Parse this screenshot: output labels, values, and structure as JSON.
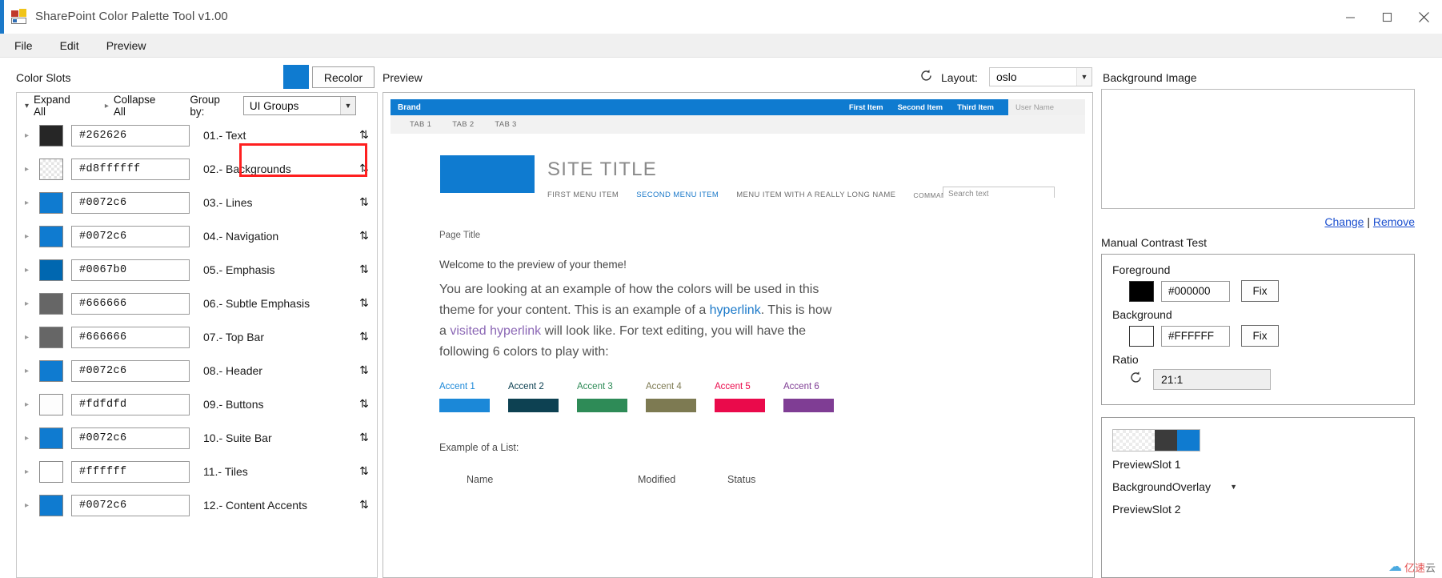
{
  "window": {
    "title": "SharePoint Color Palette Tool v1.00",
    "icon": "app-palette-icon",
    "minimize": "minimize-icon",
    "maximize": "maximize-icon",
    "close": "close-icon"
  },
  "menubar": {
    "items": [
      {
        "label": "File"
      },
      {
        "label": "Edit"
      },
      {
        "label": "Preview"
      }
    ]
  },
  "left_panel": {
    "heading": "Color Slots",
    "recolor_label": "Recolor",
    "recolor_swatch_color": "#0f7bd0",
    "toolbar": {
      "expand_all": "Expand All",
      "collapse_all": "Collapse All",
      "group_by_label": "Group by:",
      "group_by_value": "UI Groups",
      "highlight_color": "#ff1f1f"
    },
    "sort_glyph": "⇅",
    "slots": [
      {
        "hex": "#262626",
        "name": "01.- Text",
        "color": "#262626",
        "checker": false
      },
      {
        "hex": "#d8ffffff",
        "name": "02.- Backgrounds",
        "color": "",
        "checker": true
      },
      {
        "hex": "#0072c6",
        "name": "03.- Lines",
        "color": "#0f7bd0",
        "checker": false
      },
      {
        "hex": "#0072c6",
        "name": "04.- Navigation",
        "color": "#0f7bd0",
        "checker": false
      },
      {
        "hex": "#0067b0",
        "name": "05.- Emphasis",
        "color": "#0067b0",
        "checker": false
      },
      {
        "hex": "#666666",
        "name": "06.- Subtle Emphasis",
        "color": "#666666",
        "checker": false
      },
      {
        "hex": "#666666",
        "name": "07.- Top Bar",
        "color": "#666666",
        "checker": false
      },
      {
        "hex": "#0072c6",
        "name": "08.- Header",
        "color": "#0f7bd0",
        "checker": false
      },
      {
        "hex": "#fdfdfd",
        "name": "09.- Buttons",
        "color": "#fdfdfd",
        "checker": false
      },
      {
        "hex": "#0072c6",
        "name": "10.- Suite Bar",
        "color": "#0f7bd0",
        "checker": false
      },
      {
        "hex": "#ffffff",
        "name": "11.- Tiles",
        "color": "#ffffff",
        "checker": false
      },
      {
        "hex": "#0072c6",
        "name": "12.- Content Accents",
        "color": "#0f7bd0",
        "checker": false
      }
    ]
  },
  "center_panel": {
    "heading": "Preview",
    "refresh_icon": "refresh-icon",
    "layout_label": "Layout:",
    "layout_value": "oslo",
    "preview": {
      "suite_bar": {
        "brand": "Brand",
        "links": [
          "First Item",
          "Second Item",
          "Third Item"
        ],
        "user_name": "User Name",
        "bg_color": "#0f7bd0"
      },
      "tabs": [
        "TAB 1",
        "TAB 2",
        "TAB 3"
      ],
      "site_title": "SITE TITLE",
      "logo_color": "#0f7bd0",
      "menu": [
        "FIRST MENU ITEM",
        "SECOND MENU ITEM",
        "MENU ITEM WITH A REALLY LONG NAME",
        "COMMAND LINK"
      ],
      "search_placeholder": "Search text",
      "page_title": "Page Title",
      "welcome": "Welcome to the preview of your theme!",
      "paragraph_1": "You are looking at an example of how the colors will be used in this theme for your content. This is an example of a ",
      "hyperlink": "hyperlink",
      "paragraph_2": ". This is how a ",
      "visited_hyperlink": "visited hyperlink",
      "paragraph_3": " will look like. For text editing, you will have the following 6 colors to play with:",
      "accents": [
        {
          "label": "Accent 1",
          "color": "#1b88d8"
        },
        {
          "label": "Accent 2",
          "color": "#0d4152"
        },
        {
          "label": "Accent 3",
          "color": "#2e8b57"
        },
        {
          "label": "Accent 4",
          "color": "#7d7a52"
        },
        {
          "label": "Accent 5",
          "color": "#ea0a4b"
        },
        {
          "label": "Accent 6",
          "color": "#7f3d94"
        }
      ],
      "list_label": "Example of a List:",
      "list_headers": [
        "Name",
        "Modified",
        "Status"
      ]
    }
  },
  "right_panel": {
    "bg_image_label": "Background Image",
    "change_link": "Change",
    "separator": "|",
    "remove_link": "Remove",
    "contrast": {
      "heading": "Manual Contrast Test",
      "foreground_label": "Foreground",
      "foreground_hex": "#000000",
      "foreground_color": "#000000",
      "foreground_fix": "Fix",
      "background_label": "Background",
      "background_hex": "#FFFFFF",
      "background_color": "#FFFFFF",
      "background_fix": "Fix",
      "ratio_label": "Ratio",
      "ratio_refresh_icon": "refresh-icon",
      "ratio_value": "21:1"
    },
    "preview_slots": {
      "slot1_title": "PreviewSlot 1",
      "slot1_value": "BackgroundOverlay",
      "slot2_title": "PreviewSlot 2"
    }
  },
  "watermark": {
    "cloud": "☁",
    "text_red": "亿速",
    "text_gray": "云"
  }
}
